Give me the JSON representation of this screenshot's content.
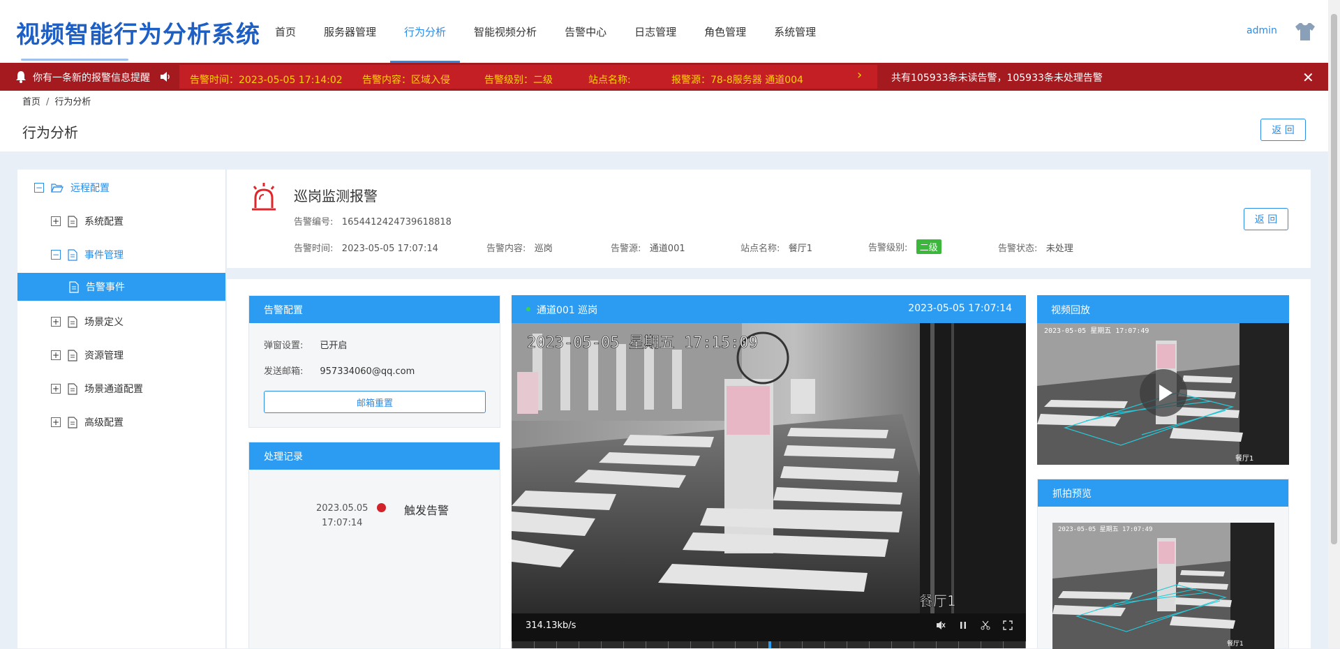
{
  "app": {
    "title": "视频智能行为分析系统",
    "user": "admin",
    "accent": "#2b8ce8",
    "alert_color": "#a51a1f"
  },
  "nav": [
    {
      "label": "首页",
      "active": false
    },
    {
      "label": "服务器管理",
      "active": false
    },
    {
      "label": "行为分析",
      "active": true
    },
    {
      "label": "智能视频分析",
      "active": false
    },
    {
      "label": "告警中心",
      "active": false
    },
    {
      "label": "日志管理",
      "active": false
    },
    {
      "label": "角色管理",
      "active": false
    },
    {
      "label": "系统管理",
      "active": false
    }
  ],
  "alert_bar": {
    "title": "你有一条新的报警信息提醒",
    "time": "告警时间：2023-05-05 17:14:02",
    "content": "告警内容：区域入侵",
    "level": "告警级别：二级",
    "site": "站点名称:",
    "source": "报警源：78-8服务器 通道004",
    "summary": "共有105933条未读告警，105933条未处理告警"
  },
  "breadcrumb": {
    "home": "首页",
    "sep": "/",
    "current": "行为分析"
  },
  "page": {
    "title": "行为分析",
    "back_label": "返 回"
  },
  "sidebar": {
    "root": "远程配置",
    "items": [
      {
        "label": "系统配置"
      },
      {
        "label": "事件管理"
      },
      {
        "label": "告警事件"
      },
      {
        "label": "场景定义"
      },
      {
        "label": "资源管理"
      },
      {
        "label": "场景通道配置"
      },
      {
        "label": "高级配置"
      }
    ]
  },
  "alarm": {
    "title": "巡岗监测报警",
    "id_label": "告警编号:",
    "id": "1654412424739618818",
    "time_label": "告警时间:",
    "time": "2023-05-05 17:07:14",
    "content_label": "告警内容:",
    "content": "巡岗",
    "source_label": "告警源:",
    "source": "通道001",
    "site_label": "站点名称:",
    "site": "餐厅1",
    "level_label": "告警级别:",
    "level": "二级",
    "status_label": "告警状态:",
    "status": "未处理",
    "back_label": "返 回"
  },
  "alarm_config": {
    "title": "告警配置",
    "popup_label": "弹窗设置:",
    "popup_value": "已开启",
    "email_label": "发送邮箱:",
    "email_value": "957334060@qq.com",
    "reset_label": "邮箱重置"
  },
  "records": {
    "title": "处理记录",
    "items": [
      {
        "date": "2023.05.05",
        "time": "17:07:14",
        "event": "触发告警"
      }
    ]
  },
  "live": {
    "title": "通道001 巡岗",
    "timestamp": "2023-05-05 17:07:14",
    "osd_time": "2023-05-05 星期五 17:15:09",
    "osd_name": "餐厅1",
    "bitrate": "314.13kb/s"
  },
  "playback": {
    "title": "视频回放",
    "osd_time": "2023-05-05 星期五 17:07:49",
    "osd_name": "餐厅1"
  },
  "snapshot": {
    "title": "抓拍预览",
    "osd_time": "2023-05-05 星期五 17:07:49",
    "osd_name": "餐厅1"
  }
}
